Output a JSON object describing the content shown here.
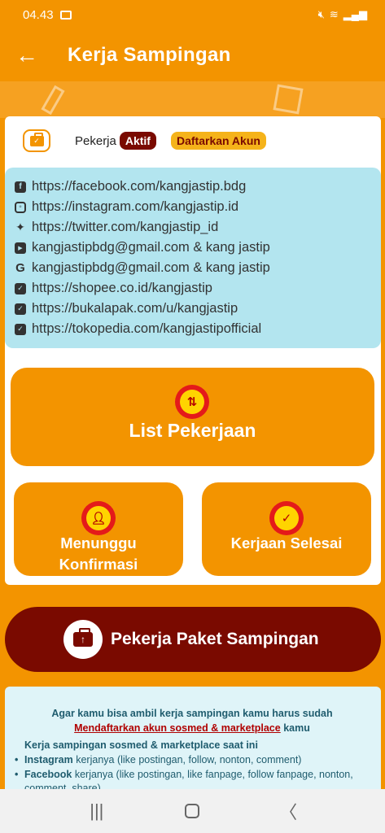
{
  "statusbar": {
    "time": "04.43"
  },
  "appbar": {
    "title": "Kerja Sampingan"
  },
  "status": {
    "label": "Pekerja",
    "state": "Aktif",
    "register": "Daftarkan Akun"
  },
  "social": [
    {
      "icon": "facebook-icon",
      "glyph": "f",
      "text": "https://facebook.com/kangjastip.bdg"
    },
    {
      "icon": "instagram-icon",
      "glyph": "",
      "text": "https://instagram.com/kangjastip.id"
    },
    {
      "icon": "twitter-icon",
      "glyph": "✦",
      "text": "https://twitter.com/kangjastip_id"
    },
    {
      "icon": "youtube-icon",
      "glyph": "▶",
      "text": "kangjastipbdg@gmail.com & kang jastip"
    },
    {
      "icon": "google-icon",
      "glyph": "G",
      "text": "kangjastipbdg@gmail.com & kang jastip"
    },
    {
      "icon": "shopping-bag-icon",
      "glyph": "✓",
      "text": "https://shopee.co.id/kangjastip"
    },
    {
      "icon": "shopping-bag-icon",
      "glyph": "✓",
      "text": "https://bukalapak.com/u/kangjastip"
    },
    {
      "icon": "shopping-bag-icon",
      "glyph": "✓",
      "text": "https://tokopedia.com/kangjastipofficial"
    }
  ],
  "buttons": {
    "list": "List Pekerjaan",
    "waiting_line1": "Menunggu",
    "waiting_line2": "Konfirmasi",
    "done": "Kerjaan Selesai",
    "paket": "Pekerja Paket Sampingan"
  },
  "info": {
    "intro": "Agar kamu bisa ambil kerja sampingan kamu harus sudah ",
    "link": "Mendaftarkan akun sosmed & marketplace",
    "intro_end": " kamu",
    "heading": "Kerja sampingan sosmed & marketplace saat ini",
    "items": [
      {
        "name": "Instagram",
        "desc": " kerjanya (like postingan, follow, nonton, comment)"
      },
      {
        "name": "Facebook",
        "desc": " kerjanya  (like postingan, like fanpage, follow fanpage, nonton, comment, share)"
      }
    ]
  }
}
